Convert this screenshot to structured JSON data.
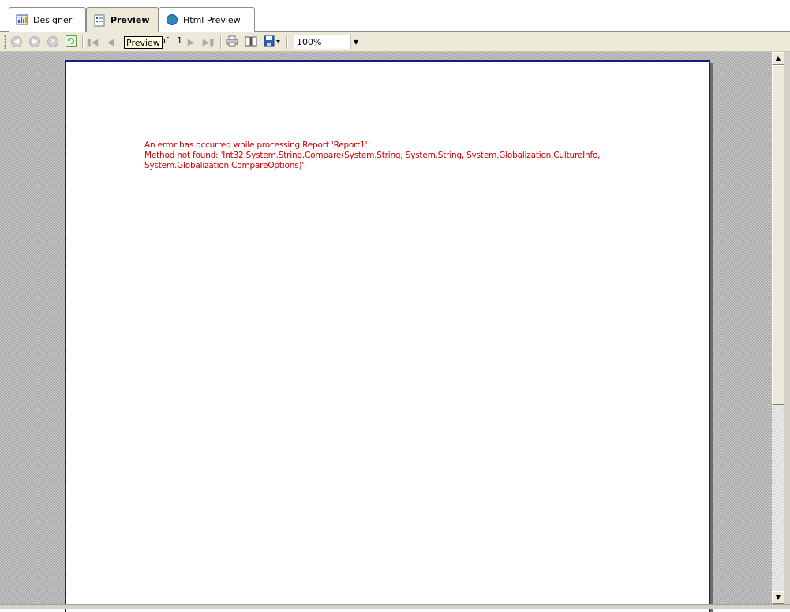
{
  "tabs": [
    {
      "label": "Designer",
      "icon": "designer-icon"
    },
    {
      "label": "Preview",
      "icon": "preview-icon"
    },
    {
      "label": "Html Preview",
      "icon": "globe-icon"
    }
  ],
  "toolbar": {
    "page_current": "",
    "page_of": "of",
    "page_total": "1",
    "tooltip": "Preview",
    "zoom": "100%"
  },
  "report": {
    "error_lines": [
      "An error has occurred while processing Report 'Report1':",
      "Method not found: 'Int32 System.String.Compare(System.String, System.String, System.Globalization.CultureInfo,",
      "System.Globalization.CompareOptions)'."
    ]
  },
  "colors": {
    "error": "#cc0000",
    "page_border": "#1a1a7a"
  }
}
